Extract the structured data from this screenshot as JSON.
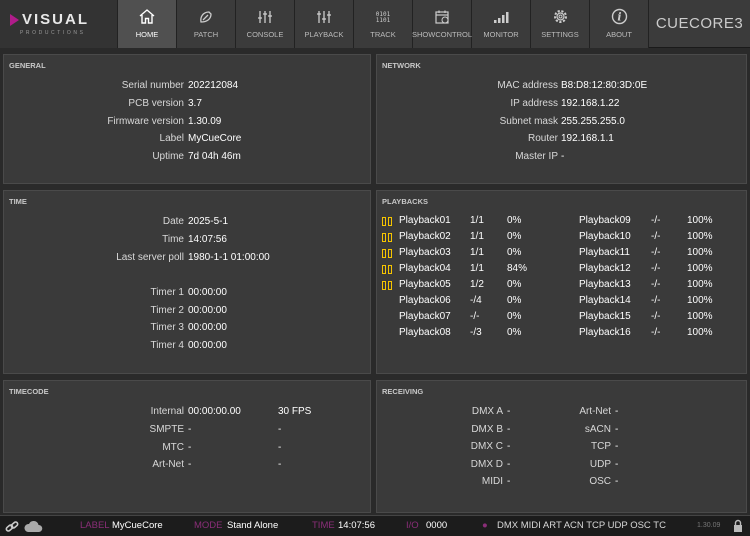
{
  "brand": {
    "name": "VISUAL",
    "sub": "PRODUCTIONS"
  },
  "nav": [
    {
      "key": "home",
      "label": "HOME",
      "active": true
    },
    {
      "key": "patch",
      "label": "PATCH"
    },
    {
      "key": "console",
      "label": "CONSOLE"
    },
    {
      "key": "playback",
      "label": "PLAYBACK"
    },
    {
      "key": "track",
      "label": "TRACK",
      "glyph_top": "0101",
      "glyph_bottom": "1101"
    },
    {
      "key": "showcontrol",
      "label": "SHOWCONTROL"
    },
    {
      "key": "monitor",
      "label": "MONITOR"
    },
    {
      "key": "settings",
      "label": "SETTINGS"
    },
    {
      "key": "about",
      "label": "ABOUT"
    }
  ],
  "device": "CUECORE3",
  "general": {
    "title": "GENERAL",
    "rows": [
      {
        "label": "Serial number",
        "value": "202212084"
      },
      {
        "label": "PCB version",
        "value": "3.7"
      },
      {
        "label": "Firmware version",
        "value": "1.30.09"
      },
      {
        "label": "Label",
        "value": "MyCueCore"
      },
      {
        "label": "Uptime",
        "value": "7d 04h 46m"
      }
    ]
  },
  "network": {
    "title": "NETWORK",
    "rows": [
      {
        "label": "MAC address",
        "value": "B8:D8:12:80:3D:0E"
      },
      {
        "label": "IP address",
        "value": "192.168.1.22"
      },
      {
        "label": "Subnet mask",
        "value": "255.255.255.0"
      },
      {
        "label": "Router",
        "value": "192.168.1.1"
      },
      {
        "label": "Master IP",
        "value": "-"
      }
    ]
  },
  "time": {
    "title": "TIME",
    "rows": [
      {
        "label": "Date",
        "value": "2025-5-1"
      },
      {
        "label": "Time",
        "value": "14:07:56"
      },
      {
        "label": "Last server poll",
        "value": "1980-1-1 01:00:00"
      }
    ],
    "timers": [
      {
        "label": "Timer 1",
        "value": "00:00:00"
      },
      {
        "label": "Timer 2",
        "value": "00:00:00"
      },
      {
        "label": "Timer 3",
        "value": "00:00:00"
      },
      {
        "label": "Timer 4",
        "value": "00:00:00"
      }
    ]
  },
  "playbacks": {
    "title": "PLAYBACKS",
    "left": [
      {
        "name": "Playback01",
        "cue": "1/1",
        "level": "0%",
        "active": true
      },
      {
        "name": "Playback02",
        "cue": "1/1",
        "level": "0%",
        "active": true
      },
      {
        "name": "Playback03",
        "cue": "1/1",
        "level": "0%",
        "active": true
      },
      {
        "name": "Playback04",
        "cue": "1/1",
        "level": "84%",
        "active": true
      },
      {
        "name": "Playback05",
        "cue": "1/2",
        "level": "0%",
        "active": true
      },
      {
        "name": "Playback06",
        "cue": "-/4",
        "level": "0%",
        "active": false
      },
      {
        "name": "Playback07",
        "cue": "-/-",
        "level": "0%",
        "active": false
      },
      {
        "name": "Playback08",
        "cue": "-/3",
        "level": "0%",
        "active": false
      }
    ],
    "right": [
      {
        "name": "Playback09",
        "cue": "-/-",
        "level": "100%"
      },
      {
        "name": "Playback10",
        "cue": "-/-",
        "level": "100%"
      },
      {
        "name": "Playback11",
        "cue": "-/-",
        "level": "100%"
      },
      {
        "name": "Playback12",
        "cue": "-/-",
        "level": "100%"
      },
      {
        "name": "Playback13",
        "cue": "-/-",
        "level": "100%"
      },
      {
        "name": "Playback14",
        "cue": "-/-",
        "level": "100%"
      },
      {
        "name": "Playback15",
        "cue": "-/-",
        "level": "100%"
      },
      {
        "name": "Playback16",
        "cue": "-/-",
        "level": "100%"
      }
    ]
  },
  "timecode": {
    "title": "TIMECODE",
    "rows": [
      {
        "label": "Internal",
        "value": "00:00:00.00",
        "extra": "30 FPS"
      },
      {
        "label": "SMPTE",
        "value": "-",
        "extra": "-"
      },
      {
        "label": "MTC",
        "value": "-",
        "extra": "-"
      },
      {
        "label": "Art-Net",
        "value": "-",
        "extra": "-"
      }
    ]
  },
  "receiving": {
    "title": "RECEIVING",
    "left": [
      {
        "label": "DMX A",
        "value": "-"
      },
      {
        "label": "DMX B",
        "value": "-"
      },
      {
        "label": "DMX C",
        "value": "-"
      },
      {
        "label": "DMX D",
        "value": "-"
      },
      {
        "label": "MIDI",
        "value": "-"
      }
    ],
    "right": [
      {
        "label": "Art-Net",
        "value": "-"
      },
      {
        "label": "sACN",
        "value": "-"
      },
      {
        "label": "TCP",
        "value": "-"
      },
      {
        "label": "UDP",
        "value": "-"
      },
      {
        "label": "OSC",
        "value": "-"
      }
    ]
  },
  "status": {
    "label_tag": "LABEL",
    "label": "MyCueCore",
    "mode_tag": "MODE",
    "mode": "Stand Alone",
    "time_tag": "TIME",
    "time": "14:07:56",
    "io_tag": "I/O",
    "io": "0000",
    "proto": "DMX MIDI ART ACN TCP UDP OSC TC",
    "version": "1.30.09"
  },
  "colors": {
    "accent": "#f5c400",
    "brand": "#b01c8a"
  }
}
